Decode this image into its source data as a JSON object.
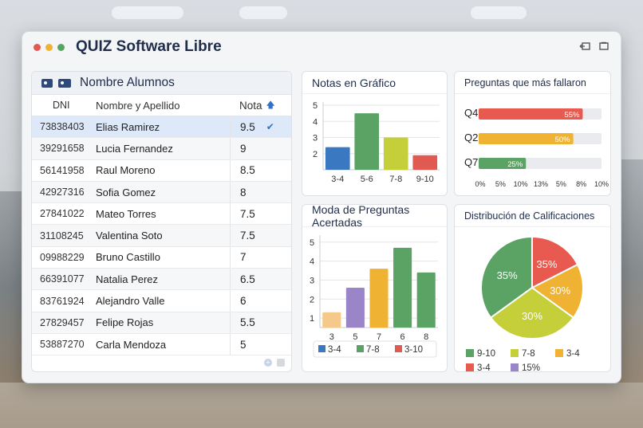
{
  "app": {
    "title": "QUIZ Software Libre"
  },
  "students": {
    "title": "Nombre Alumnos",
    "columns": {
      "dni": "DNI",
      "name": "Nombre y Apellido",
      "grade": "Nota"
    },
    "rows": [
      {
        "dni": "73838403",
        "name": "Elias Ramirez",
        "grade": "9.5"
      },
      {
        "dni": "39291658",
        "name": "Lucia Fernandez",
        "grade": "9"
      },
      {
        "dni": "56141958",
        "name": "Raul Moreno",
        "grade": "8.5"
      },
      {
        "dni": "42927316",
        "name": "Sofia Gomez",
        "grade": "8"
      },
      {
        "dni": "27841022",
        "name": "Mateo Torres",
        "grade": "7.5"
      },
      {
        "dni": "31108245",
        "name": "Valentina Soto",
        "grade": "7.5"
      },
      {
        "dni": "09988229",
        "name": "Bruno Castillo",
        "grade": "7"
      },
      {
        "dni": "66391077",
        "name": "Natalia Perez",
        "grade": "6.5"
      },
      {
        "dni": "83761924",
        "name": "Alejandro Valle",
        "grade": "6"
      },
      {
        "dni": "27829457",
        "name": "Felipe Rojas",
        "grade": "5.5"
      },
      {
        "dni": "53887270",
        "name": "Carla Mendoza",
        "grade": "5"
      }
    ]
  },
  "panels": {
    "grades_title": "Notas en Gráfico",
    "failed_title": "Preguntas que más fallaron",
    "moda_title": "Moda de Preguntas Acertadas",
    "dist_title": "Distribución de Calificaciones"
  },
  "colors": {
    "blue": "#3a78c2",
    "green": "#5aa364",
    "yellow": "#c5cf3a",
    "red": "#e05a52",
    "orange": "#f0b232",
    "purple": "#9b85c9",
    "peach": "#f5c98a",
    "red2": "#e85a4f"
  },
  "chart_data": [
    {
      "type": "bar",
      "categories": [
        "3-4",
        "5-6",
        "7-8",
        "9-10"
      ],
      "values": [
        2.4,
        4.5,
        3.0,
        1.9
      ],
      "ylim": [
        1,
        5
      ],
      "yticks": [
        "2",
        "3",
        "4",
        "5"
      ],
      "colors": [
        "#3a78c2",
        "#5aa364",
        "#c5cf3a",
        "#e05a52"
      ]
    },
    {
      "type": "bar",
      "orientation": "horizontal",
      "categories": [
        "Q4",
        "Q2",
        "Q7"
      ],
      "values": [
        55,
        50,
        25
      ],
      "labels": [
        "55%",
        "50%",
        "25%"
      ],
      "xticks": [
        "0%",
        "5%",
        "10%",
        "13%",
        "5%",
        "8%",
        "10%"
      ],
      "colors": [
        "#e85a4f",
        "#f0b232",
        "#5aa364"
      ]
    },
    {
      "type": "bar",
      "categories": [
        "3",
        "5",
        "7",
        "6",
        "8"
      ],
      "values": [
        1.3,
        2.6,
        3.6,
        4.7,
        3.4
      ],
      "ylim": [
        0.5,
        5.2
      ],
      "yticks": [
        "1",
        "2",
        "3",
        "4",
        "5"
      ],
      "colors": [
        "#f5c98a",
        "#9b85c9",
        "#f0b232",
        "#5aa364",
        "#5aa364"
      ],
      "legend": [
        {
          "label": "3-4",
          "color": "#3a78c2"
        },
        {
          "label": "7-8",
          "color": "#5aa364"
        },
        {
          "label": "3-10",
          "color": "#e05a52"
        }
      ]
    },
    {
      "type": "pie",
      "slices": [
        {
          "label": "35%",
          "value": 35,
          "color": "#5aa364"
        },
        {
          "label": "35%",
          "value": 17.5,
          "color": "#e85a4f"
        },
        {
          "label": "30%",
          "value": 17.5,
          "color": "#f0b232"
        },
        {
          "label": "30%",
          "value": 30,
          "color": "#c5cf3a"
        }
      ],
      "legend": [
        {
          "label": "9-10",
          "color": "#5aa364"
        },
        {
          "label": "7-8",
          "color": "#c5cf3a"
        },
        {
          "label": "3-4",
          "color": "#f0b232"
        },
        {
          "label": "3-4",
          "color": "#e85a4f"
        },
        {
          "label": "15%",
          "color": "#9b85c9"
        }
      ]
    }
  ]
}
